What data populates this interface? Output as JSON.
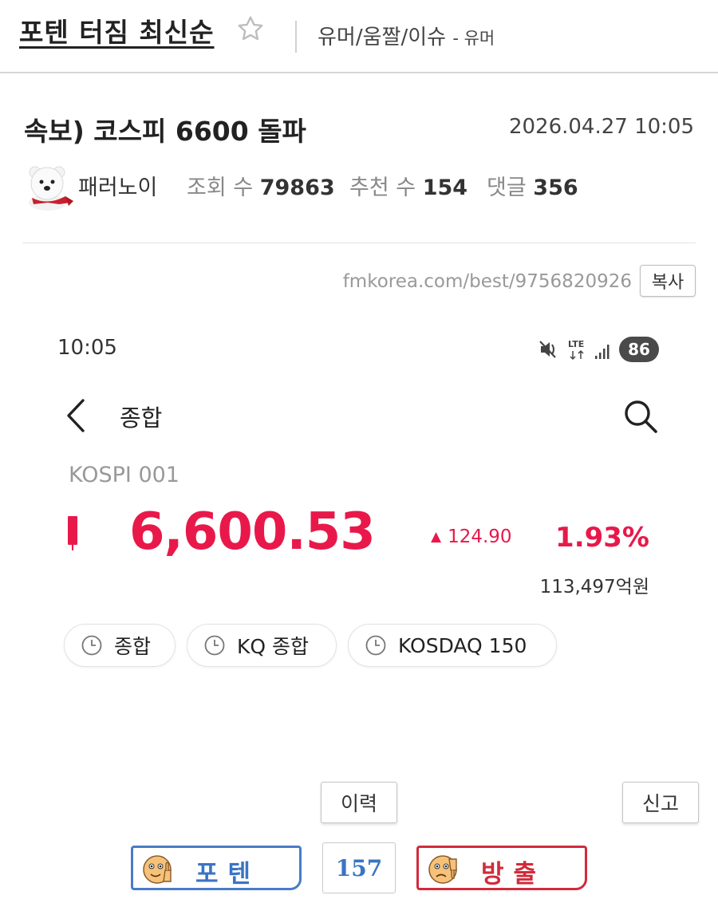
{
  "board": {
    "title": "포텐 터짐 최신순",
    "category": "유머/움짤/이슈",
    "subcategory": "- 유머"
  },
  "post": {
    "title": "속보) 코스피 6600 돌파",
    "date": "2026.04.27 10:05",
    "author": "패러노이",
    "views_label": "조회 수",
    "views": "79863",
    "recommend_label": "추천 수",
    "recommend": "154",
    "comments_label": "댓글",
    "comments": "356",
    "url": "fmkorea.com/best/9756820926",
    "copy_label": "복사"
  },
  "screenshot": {
    "status_time": "10:05",
    "network": "LTE",
    "battery": "86",
    "screen_title": "종합",
    "index_name": "KOSPI 001",
    "index_value": "6,600.53",
    "change": "124.90",
    "change_pct": "1.93%",
    "volume": "113,497억원",
    "chips": [
      "종합",
      "KQ 종합",
      "KOSDAQ 150"
    ]
  },
  "actions": {
    "history_label": "이력",
    "report_label": "신고",
    "upvote_label": "포텐",
    "vote_count": "157",
    "downvote_label": "방출"
  },
  "colors": {
    "price_up": "#e8194a",
    "upvote": "#3a74c4",
    "downvote": "#d12b3b"
  },
  "icons": [
    "star-icon",
    "avatar-polar-bear",
    "back-icon",
    "search-icon",
    "mute-icon",
    "signal-icon",
    "candle-icon",
    "clock-icon",
    "thumbs-up-face-icon",
    "thumbs-down-face-icon"
  ]
}
